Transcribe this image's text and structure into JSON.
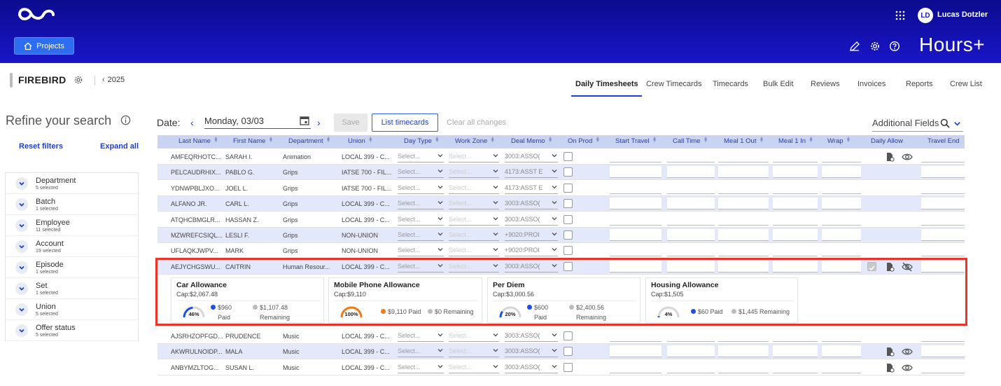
{
  "header": {
    "projects_label": "Projects",
    "avatar_initials": "LD",
    "username": "Lucas Dotzler",
    "brand": "Hours+"
  },
  "production": {
    "name": "FIREBIRD",
    "year": "2025"
  },
  "tabs": [
    "Daily Timesheets",
    "Crew Timecards",
    "Timecards",
    "Bulk Edit",
    "Reviews",
    "Invoices",
    "Reports",
    "Crew List"
  ],
  "sidebar": {
    "title": "Refine your search",
    "reset": "Reset filters",
    "expand": "Expand all",
    "filters": [
      {
        "label": "Department",
        "sub": "5 selected"
      },
      {
        "label": "Batch",
        "sub": "1 selected"
      },
      {
        "label": "Employee",
        "sub": "11 selected"
      },
      {
        "label": "Account",
        "sub": "19 selected"
      },
      {
        "label": "Episode",
        "sub": "1 selected"
      },
      {
        "label": "Set",
        "sub": "1 selected"
      },
      {
        "label": "Union",
        "sub": "5 selected"
      },
      {
        "label": "Offer status",
        "sub": "5 selected"
      }
    ]
  },
  "controls": {
    "date_label": "Date:",
    "date_value": "Monday, 03/03",
    "save": "Save",
    "list_timecards": "List timecards",
    "clear_changes": "Clear all changes",
    "additional_fields": "Additional Fields"
  },
  "table": {
    "columns": [
      "Last Name",
      "First Name",
      "Department",
      "Union",
      "Day Type",
      "Work Zone",
      "Deal Memo",
      "On Prod",
      "Start Travel",
      "Call Time",
      "Meal 1 Out",
      "Meal 1 In",
      "Wrap",
      "Daily Allow",
      "Travel End"
    ],
    "select_placeholder": "Select...",
    "rows": [
      {
        "last": "AMFEQRHOTC...",
        "first": "SARAH I.",
        "dept": "Animation",
        "union": "LOCAL 399 - C...",
        "memo": "3003:ASSO(",
        "icons": "doc-eye"
      },
      {
        "last": "PELCAUDRHIX...",
        "first": "PABLO G.",
        "dept": "Grips",
        "union": "IATSE 700 - FIL...",
        "memo": "4173:ASST E",
        "icons": ""
      },
      {
        "last": "YDNWPBLJXO...",
        "first": "JOEL L.",
        "dept": "Grips",
        "union": "IATSE 700 - FIL...",
        "memo": "4173:ASST E",
        "icons": ""
      },
      {
        "last": "ALFANO JR.",
        "first": "CARL L.",
        "dept": "Grips",
        "union": "LOCAL 399 - C...",
        "memo": "3003:ASSO(",
        "icons": ""
      },
      {
        "last": "ATQHCBMGLR...",
        "first": "HASSAN Z.",
        "dept": "Grips",
        "union": "LOCAL 399 - C...",
        "memo": "3003:ASSO(",
        "icons": ""
      },
      {
        "last": "MZWREFCSIQL...",
        "first": "LESLI F.",
        "dept": "Grips",
        "union": "NON-UNION",
        "memo": "+9020:PROI",
        "icons": ""
      },
      {
        "last": "UFLAQKJWPV...",
        "first": "MARK",
        "dept": "Grips",
        "union": "NON-UNION",
        "memo": "+9020:PROI",
        "icons": ""
      },
      {
        "last": "AEJYCHGSWU...",
        "first": "CAITRIN",
        "dept": "Human Resour...",
        "union": "LOCAL 399 - C...",
        "memo": "3003:ASSO(",
        "icons": "chk-doc-eyeoff"
      }
    ],
    "rows_after": [
      {
        "last": "AJSRHZOPFGD...",
        "first": "PRUDENCE",
        "dept": "Music",
        "union": "LOCAL 399 - C...",
        "memo": "3003:ASSO(",
        "icons": ""
      },
      {
        "last": "AKWRULNOIDP...",
        "first": "MALA",
        "dept": "Music",
        "union": "LOCAL 399 - C...",
        "memo": "3003:ASSO(",
        "icons": "doc-eye"
      },
      {
        "last": "ANBYMZLTOG...",
        "first": "SUSAN L.",
        "dept": "Music",
        "union": "LOCAL 399 - C...",
        "memo": "3003:ASSO(",
        "icons": "doc-eye"
      }
    ]
  },
  "allowances": [
    {
      "title": "Car Allowance",
      "cap": "Cap:$2,067.48",
      "pct": 46,
      "pct_label": "46%",
      "paid": "$960",
      "remaining": "$1,107.48",
      "paid_label": "Paid",
      "remaining_label": "Remaining",
      "color": "#1f4fe0",
      "layout": "split"
    },
    {
      "title": "Mobile Phone Allowance",
      "cap": "Cap:$9,110",
      "pct": 100,
      "pct_label": "100%",
      "paid": "$9,110 Paid",
      "remaining": "$0 Remaining",
      "color": "#f07a1a",
      "layout": "inline"
    },
    {
      "title": "Per Diem",
      "cap": "Cap:$3,000.56",
      "pct": 20,
      "pct_label": "20%",
      "paid": "$600",
      "remaining": "$2,400.56",
      "paid_label": "Paid",
      "remaining_label": "Remaining",
      "color": "#1f4fe0",
      "layout": "split"
    },
    {
      "title": "Housing Allowance",
      "cap": "Cap:$1,505",
      "pct": 4,
      "pct_label": "4%",
      "paid": "$60 Paid",
      "remaining": "$1,445 Remaining",
      "color": "#1f4fe0",
      "layout": "inline"
    }
  ]
}
